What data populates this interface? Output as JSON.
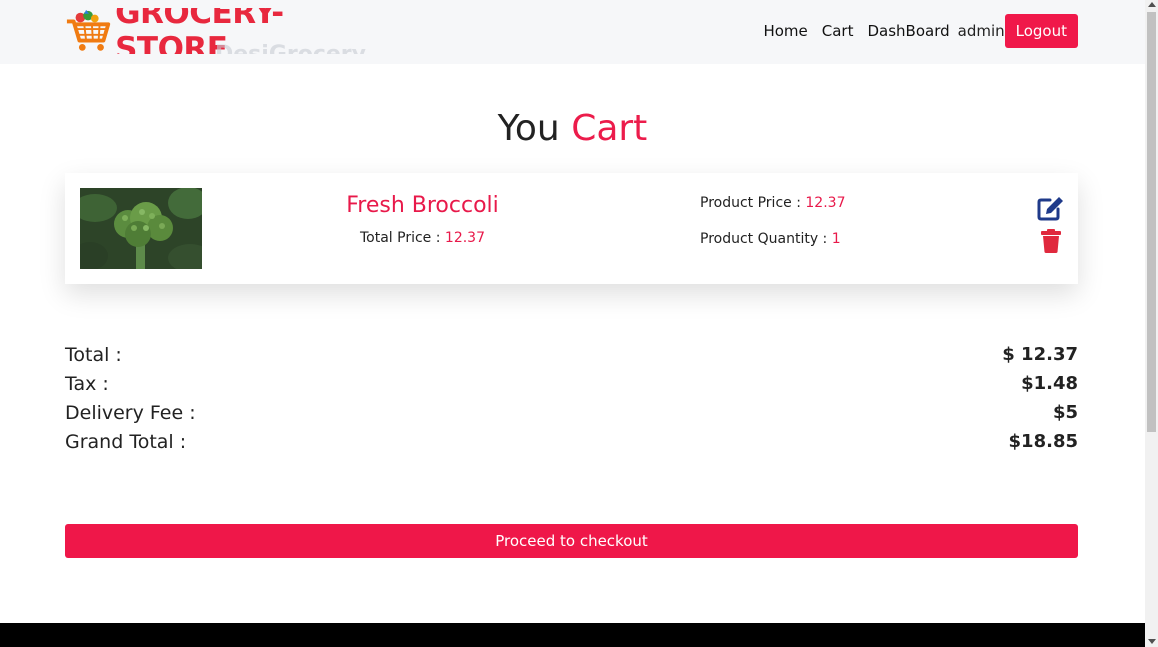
{
  "header": {
    "logo_text": "GROCERY-STORE",
    "logo_ghost_text": "DesiGrocery",
    "nav_links": [
      "Home",
      "Cart",
      "DashBoard"
    ],
    "user": "admin",
    "logout_label": "Logout"
  },
  "title": {
    "prefix": "You",
    "accent": "Cart"
  },
  "cart_items": [
    {
      "image_icon": "broccoli-image",
      "name": "Fresh Broccoli",
      "total_price_label": "Total Price : ",
      "total_price": "12.37",
      "price_label": "Product Price : ",
      "price": "12.37",
      "quantity_label": "Product Quantity : ",
      "quantity": "1",
      "edit_icon": "edit-icon",
      "delete_icon": "trash-icon"
    }
  ],
  "summary": {
    "total_label": "Total :",
    "total_value": "$ 12.37",
    "tax_label": "Tax :",
    "tax_value": "$1.48",
    "delivery_label": "Delivery Fee :",
    "delivery_value": "$5",
    "grand_label": "Grand Total :",
    "grand_value": "$18.85"
  },
  "checkout_label": "Proceed to checkout",
  "colors": {
    "accent": "#ec1c4b",
    "button": "#ef1749",
    "icon_blue": "#1f3a8a",
    "icon_red": "#e0293e",
    "footer": "#000000"
  }
}
